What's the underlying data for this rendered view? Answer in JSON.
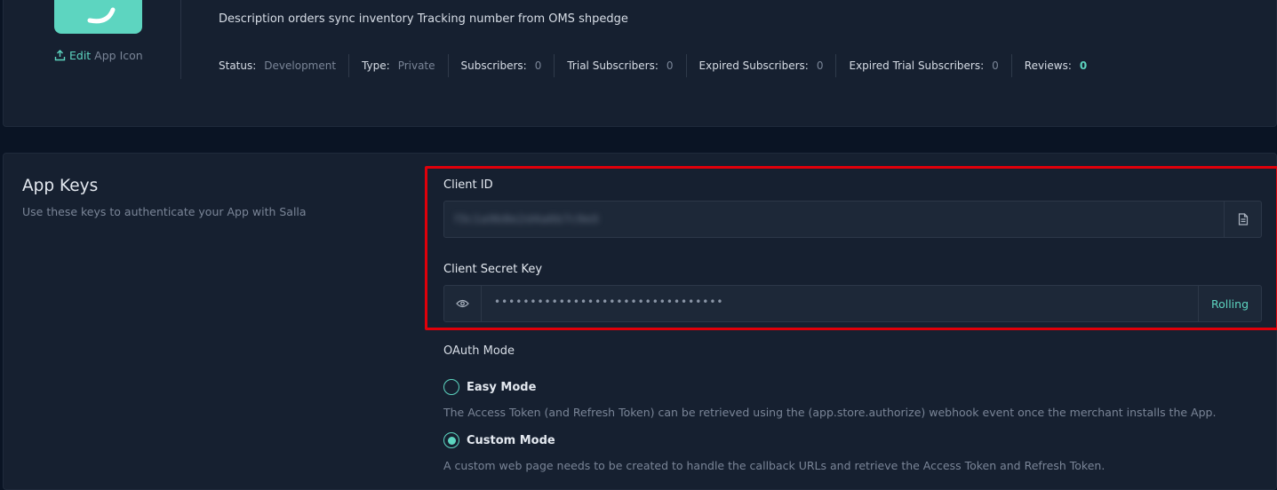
{
  "app": {
    "edit_label": "Edit",
    "edit_rest": " App Icon",
    "description": "Description orders sync inventory Tracking number from OMS shpedge",
    "stats": [
      {
        "label": "Status:",
        "value": "Development"
      },
      {
        "label": "Type:",
        "value": "Private"
      },
      {
        "label": "Subscribers:",
        "value": "0"
      },
      {
        "label": "Trial Subscribers:",
        "value": "0"
      },
      {
        "label": "Expired Subscribers:",
        "value": "0"
      },
      {
        "label": "Expired Trial Subscribers:",
        "value": "0"
      },
      {
        "label": "Reviews:",
        "value": "0"
      }
    ]
  },
  "keys": {
    "title": "App Keys",
    "subtitle": "Use these keys to authenticate your App with Salla",
    "client_id_label": "Client ID",
    "client_id_value": "f3c1a9b8e2d4a6b7c9e0",
    "client_secret_label": "Client Secret Key",
    "client_secret_value": "••••••••••••••••••••••••••••••••",
    "rolling_label": "Rolling"
  },
  "oauth": {
    "label": "OAuth Mode",
    "options": [
      {
        "label": "Easy Mode",
        "description": "The Access Token (and Refresh Token) can be retrieved using the (app.store.authorize) webhook event once the merchant installs the App.",
        "checked": false
      },
      {
        "label": "Custom Mode",
        "description": "A custom web page needs to be created to handle the callback URLs and retrieve the Access Token and Refresh Token.",
        "checked": true
      }
    ]
  },
  "colors": {
    "accent": "#5dd5c0",
    "highlight": "#e0000a",
    "background": "#0a1424",
    "card": "#162030"
  }
}
